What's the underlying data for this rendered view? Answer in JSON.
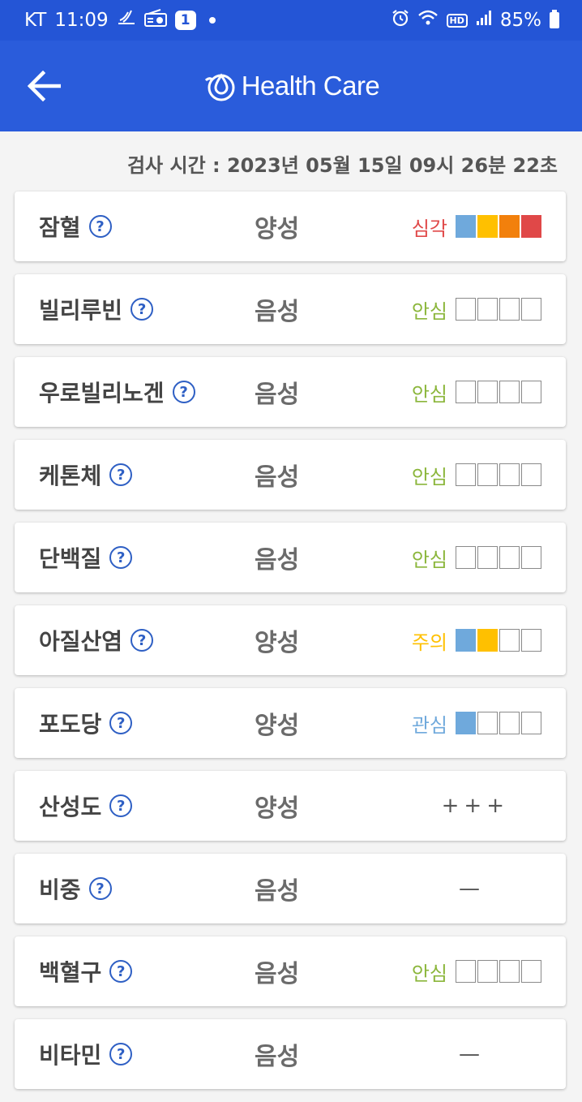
{
  "status_bar": {
    "carrier": "KT",
    "time": "11:09",
    "notification_badge": "1",
    "hd_label": "HD",
    "battery": "85%",
    "icons": [
      "sleep-icon",
      "radio-icon",
      "alarm-icon",
      "wifi-icon",
      "signal-icon",
      "battery-icon"
    ]
  },
  "app_bar": {
    "title": "Health Care",
    "icons": [
      "back-arrow-icon",
      "drop-logo-icon"
    ]
  },
  "timestamp": "검사 시간 : 2023년 05월 15일 09시 26분 22초",
  "colors": {
    "header": "#2a5cdb",
    "level_1": "#6fa9dc",
    "level_2": "#ffc000",
    "level_3": "#f2800c",
    "level_4": "#e04848",
    "label_safe": "#8bb63b",
    "label_attention": "#ffc000",
    "label_interest": "#6fa9dc",
    "label_severe": "#e04848"
  },
  "items": [
    {
      "name": "잠혈",
      "result": "양성",
      "level_label": "심각",
      "label_color": "#e04848",
      "level": 4,
      "help": "?"
    },
    {
      "name": "빌리루빈",
      "result": "음성",
      "level_label": "안심",
      "label_color": "#8bb63b",
      "level": 0,
      "help": "?"
    },
    {
      "name": "우로빌리노겐",
      "result": "음성",
      "level_label": "안심",
      "label_color": "#8bb63b",
      "level": 0,
      "help": "?"
    },
    {
      "name": "케톤체",
      "result": "음성",
      "level_label": "안심",
      "label_color": "#8bb63b",
      "level": 0,
      "help": "?"
    },
    {
      "name": "단백질",
      "result": "음성",
      "level_label": "안심",
      "label_color": "#8bb63b",
      "level": 0,
      "help": "?"
    },
    {
      "name": "아질산염",
      "result": "양성",
      "level_label": "주의",
      "label_color": "#ffc000",
      "level": 2,
      "help": "?"
    },
    {
      "name": "포도당",
      "result": "양성",
      "level_label": "관심",
      "label_color": "#6fa9dc",
      "level": 1,
      "help": "?"
    },
    {
      "name": "산성도",
      "result": "양성",
      "plain_value": "+++",
      "help": "?"
    },
    {
      "name": "비중",
      "result": "음성",
      "plain_value": "—",
      "help": "?"
    },
    {
      "name": "백혈구",
      "result": "음성",
      "level_label": "안심",
      "label_color": "#8bb63b",
      "level": 0,
      "help": "?"
    },
    {
      "name": "비타민",
      "result": "음성",
      "plain_value": "—",
      "help": "?"
    }
  ]
}
